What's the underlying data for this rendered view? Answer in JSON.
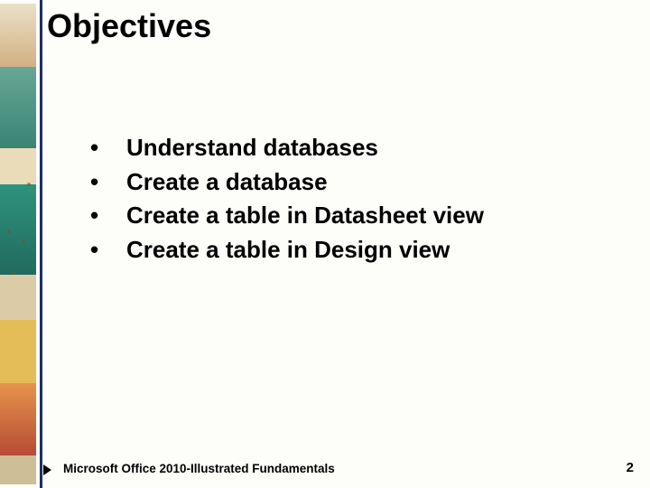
{
  "title": "Objectives",
  "bullet_char": "•",
  "bullets": [
    "Understand databases",
    "Create a database",
    "Create a table in Datasheet view",
    "Create a table in Design view"
  ],
  "footer_text": "Microsoft Office 2010-Illustrated Fundamentals",
  "page_number": "2"
}
